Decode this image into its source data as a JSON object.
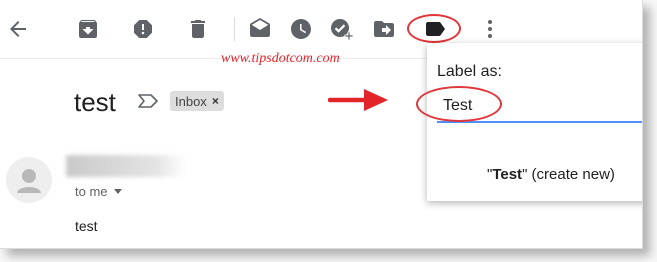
{
  "toolbar": {
    "buttons": [
      {
        "name": "back-icon",
        "title": "Back"
      },
      {
        "name": "archive-icon",
        "title": "Archive"
      },
      {
        "name": "report-spam-icon",
        "title": "Report spam"
      },
      {
        "name": "delete-icon",
        "title": "Delete"
      },
      {
        "name": "mark-unread-icon",
        "title": "Mark as unread"
      },
      {
        "name": "snooze-icon",
        "title": "Snooze"
      },
      {
        "name": "add-to-tasks-icon",
        "title": "Add to Tasks"
      },
      {
        "name": "move-to-icon",
        "title": "Move to"
      },
      {
        "name": "label-icon",
        "title": "Labels"
      },
      {
        "name": "more-vert-icon",
        "title": "More"
      }
    ],
    "highlight_color": "#e0363b"
  },
  "watermark": "www.tipsdotcom.com",
  "email": {
    "subject": "test",
    "label_chip": "Inbox",
    "chip_remove": "×",
    "to": "to me",
    "body": "test"
  },
  "label_popup": {
    "title": "Label as:",
    "input_value": "Test",
    "create_open_quote": "\"",
    "create_name": "Test",
    "create_suffix": "\" (create new)",
    "input_accent": "#4d90fe"
  },
  "annotation": {
    "arrow_color": "#e3242b"
  }
}
